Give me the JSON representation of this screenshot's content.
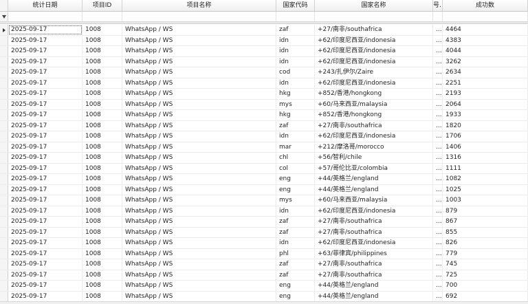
{
  "columns": [
    "统计日期",
    "项目ID",
    "项目名称",
    "国家代码",
    "国家名称",
    "号…",
    "成功数"
  ],
  "filter_row": {
    "funnel_icon": "funnel-icon"
  },
  "rows": [
    {
      "date": "2025-09-17",
      "pid": "1008",
      "pname": "WhatsApp / WS",
      "code": "zaf",
      "country": "+27/南非/southafrica",
      "trunc": "...",
      "success": "4464"
    },
    {
      "date": "2025-09-17",
      "pid": "1008",
      "pname": "WhatsApp / WS",
      "code": "idn",
      "country": "+62/印度尼西亚/indonesia",
      "trunc": "...",
      "success": "4383"
    },
    {
      "date": "2025-09-17",
      "pid": "1008",
      "pname": "WhatsApp / WS",
      "code": "idn",
      "country": "+62/印度尼西亚/indonesia",
      "trunc": "...",
      "success": "4044"
    },
    {
      "date": "2025-09-17",
      "pid": "1008",
      "pname": "WhatsApp / WS",
      "code": "idn",
      "country": "+62/印度尼西亚/indonesia",
      "trunc": "...",
      "success": "3262"
    },
    {
      "date": "2025-09-17",
      "pid": "1008",
      "pname": "WhatsApp / WS",
      "code": "cod",
      "country": "+243/扎伊尔/Zaire",
      "trunc": "...",
      "success": "2634"
    },
    {
      "date": "2025-09-17",
      "pid": "1008",
      "pname": "WhatsApp / WS",
      "code": "idn",
      "country": "+62/印度尼西亚/indonesia",
      "trunc": "...",
      "success": "2251"
    },
    {
      "date": "2025-09-17",
      "pid": "1008",
      "pname": "WhatsApp / WS",
      "code": "hkg",
      "country": "+852/香港/hongkong",
      "trunc": "...",
      "success": "2193"
    },
    {
      "date": "2025-09-17",
      "pid": "1008",
      "pname": "WhatsApp / WS",
      "code": "mys",
      "country": "+60/马来西亚/malaysia",
      "trunc": "...",
      "success": "2064"
    },
    {
      "date": "2025-09-17",
      "pid": "1008",
      "pname": "WhatsApp / WS",
      "code": "hkg",
      "country": "+852/香港/hongkong",
      "trunc": "...",
      "success": "1933"
    },
    {
      "date": "2025-09-17",
      "pid": "1008",
      "pname": "WhatsApp / WS",
      "code": "zaf",
      "country": "+27/南非/southafrica",
      "trunc": "...",
      "success": "1820"
    },
    {
      "date": "2025-09-17",
      "pid": "1008",
      "pname": "WhatsApp / WS",
      "code": "idn",
      "country": "+62/印度尼西亚/indonesia",
      "trunc": "...",
      "success": "1706"
    },
    {
      "date": "2025-09-17",
      "pid": "1008",
      "pname": "WhatsApp / WS",
      "code": "mar",
      "country": "+212/摩洛哥/morocco",
      "trunc": "...",
      "success": "1406"
    },
    {
      "date": "2025-09-17",
      "pid": "1008",
      "pname": "WhatsApp / WS",
      "code": "chl",
      "country": "+56/智利/chile",
      "trunc": "...",
      "success": "1316"
    },
    {
      "date": "2025-09-17",
      "pid": "1008",
      "pname": "WhatsApp / WS",
      "code": "col",
      "country": "+57/哥伦比亚/colombia",
      "trunc": "...",
      "success": "1111"
    },
    {
      "date": "2025-09-17",
      "pid": "1008",
      "pname": "WhatsApp / WS",
      "code": "eng",
      "country": "+44/英格兰/england",
      "trunc": "...",
      "success": "1082"
    },
    {
      "date": "2025-09-17",
      "pid": "1008",
      "pname": "WhatsApp / WS",
      "code": "eng",
      "country": "+44/英格兰/england",
      "trunc": "...",
      "success": "1025"
    },
    {
      "date": "2025-09-17",
      "pid": "1008",
      "pname": "WhatsApp / WS",
      "code": "mys",
      "country": "+60/马来西亚/malaysia",
      "trunc": "...",
      "success": "1003"
    },
    {
      "date": "2025-09-17",
      "pid": "1008",
      "pname": "WhatsApp / WS",
      "code": "idn",
      "country": "+62/印度尼西亚/indonesia",
      "trunc": "...",
      "success": "879"
    },
    {
      "date": "2025-09-17",
      "pid": "1008",
      "pname": "WhatsApp / WS",
      "code": "zaf",
      "country": "+27/南非/southafrica",
      "trunc": "...",
      "success": "867"
    },
    {
      "date": "2025-09-17",
      "pid": "1008",
      "pname": "WhatsApp / WS",
      "code": "zaf",
      "country": "+27/南非/southafrica",
      "trunc": "...",
      "success": "855"
    },
    {
      "date": "2025-09-17",
      "pid": "1008",
      "pname": "WhatsApp / WS",
      "code": "idn",
      "country": "+62/印度尼西亚/indonesia",
      "trunc": "...",
      "success": "826"
    },
    {
      "date": "2025-09-17",
      "pid": "1008",
      "pname": "WhatsApp / WS",
      "code": "phl",
      "country": "+63/菲律宾/philippines",
      "trunc": "...",
      "success": "779"
    },
    {
      "date": "2025-09-17",
      "pid": "1008",
      "pname": "WhatsApp / WS",
      "code": "zaf",
      "country": "+27/南非/southafrica",
      "trunc": "...",
      "success": "745"
    },
    {
      "date": "2025-09-17",
      "pid": "1008",
      "pname": "WhatsApp / WS",
      "code": "zaf",
      "country": "+27/南非/southafrica",
      "trunc": "...",
      "success": "725"
    },
    {
      "date": "2025-09-17",
      "pid": "1008",
      "pname": "WhatsApp / WS",
      "code": "eng",
      "country": "+44/英格兰/england",
      "trunc": "...",
      "success": "700"
    },
    {
      "date": "2025-09-17",
      "pid": "1008",
      "pname": "WhatsApp / WS",
      "code": "eng",
      "country": "+44/英格兰/england",
      "trunc": "...",
      "success": "692"
    }
  ]
}
